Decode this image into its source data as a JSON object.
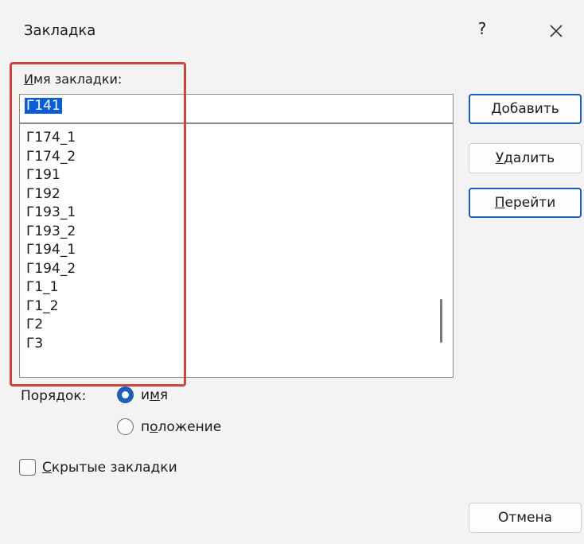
{
  "dialog": {
    "title": "Закладка",
    "help_label": "?",
    "close_icon": "close-icon"
  },
  "bookmark_name": {
    "label_first": "И",
    "label_rest": "мя закладки:",
    "value": "Г141"
  },
  "bookmark_list": {
    "items": [
      "Г174_1",
      "Г174_2",
      "Г191",
      "Г192",
      "Г193_1",
      "Г193_2",
      "Г194_1",
      "Г194_2",
      "Г1_1",
      "Г1_2",
      "Г2",
      "Г3"
    ]
  },
  "buttons": {
    "add": {
      "underlined": "Д",
      "rest": "обавить"
    },
    "delete": {
      "underlined": "У",
      "rest": "далить"
    },
    "goto": {
      "underlined": "П",
      "rest": "ерейти"
    },
    "cancel": "Отмена"
  },
  "order": {
    "label": "Порядок:",
    "name_option": {
      "before": "и",
      "underlined": "м",
      "after": "я",
      "selected": true
    },
    "position_option": {
      "before": "п",
      "underlined": "о",
      "after": "ложение",
      "selected": false
    }
  },
  "hidden_bookmarks": {
    "underlined": "С",
    "rest": "крытые закладки",
    "checked": false
  },
  "colors": {
    "accent": "#1c5fb8",
    "selection": "#0b5cd5",
    "highlight_frame": "#c9453e"
  }
}
